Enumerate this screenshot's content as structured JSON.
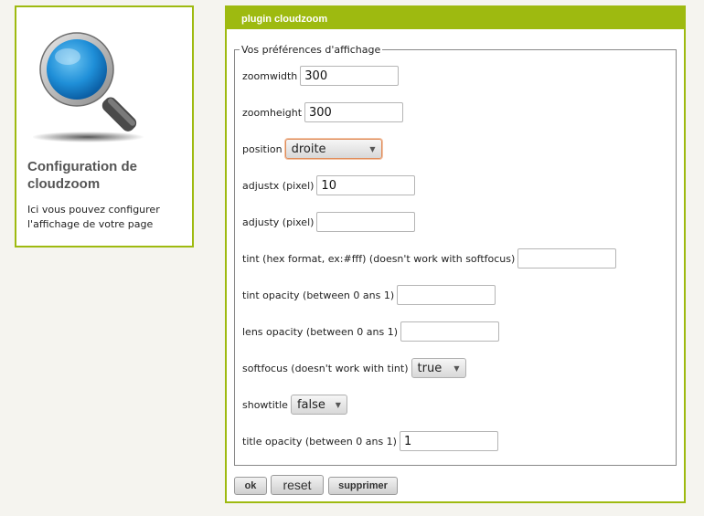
{
  "info": {
    "icon": "magnifier-icon",
    "title": "Configuration de cloudzoom",
    "text": "Ici vous pouvez configurer l'affichage de votre page"
  },
  "panel": {
    "header": "plugin cloudzoom",
    "legend": "Vos préférences d'affichage",
    "fields": {
      "zoomwidth": {
        "label": "zoomwidth",
        "value": "300"
      },
      "zoomheight": {
        "label": "zoomheight",
        "value": "300"
      },
      "position": {
        "label": "position",
        "value": "droite"
      },
      "adjustx": {
        "label": "adjustx (pixel)",
        "value": "10"
      },
      "adjusty": {
        "label": "adjusty (pixel)",
        "value": ""
      },
      "tint": {
        "label": "tint (hex format, ex:#fff) (doesn't work with softfocus)",
        "value": ""
      },
      "tint_opacity": {
        "label": "tint opacity (between 0 ans 1)",
        "value": ""
      },
      "lens_opacity": {
        "label": "lens opacity (between 0 ans 1)",
        "value": ""
      },
      "softfocus": {
        "label": "softfocus (doesn't work with tint)",
        "value": "true"
      },
      "showtitle": {
        "label": "showtitle",
        "value": "false"
      },
      "title_opacity": {
        "label": "title opacity (between 0 ans 1)",
        "value": "1"
      }
    },
    "buttons": {
      "ok": "ok",
      "reset": "reset",
      "delete": "supprimer"
    }
  },
  "colors": {
    "accent": "#9eba10",
    "focus": "#e08c5a"
  }
}
